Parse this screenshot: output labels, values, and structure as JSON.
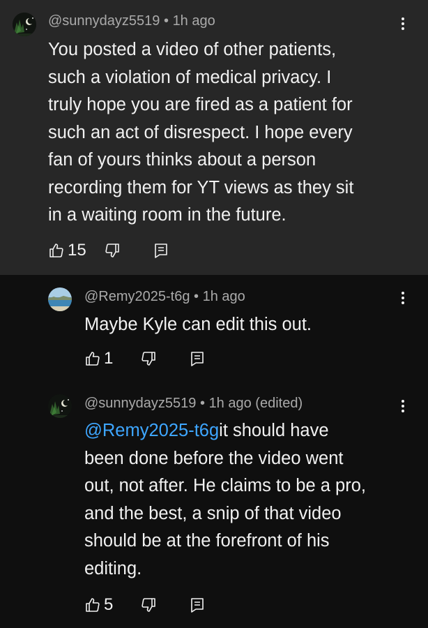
{
  "comments": [
    {
      "author": "@sunnydayz5519",
      "time": "1h ago",
      "text": "You posted a video of other patients, such a violation of medical privacy. I truly hope you are fired as a patient for such an act of disrespect. I hope every fan of yours thinks about a person recording them for YT views as they sit in a waiting room in the future.",
      "lines": [
        "You posted a video of other patients,",
        "such a violation of medical privacy. I",
        "truly hope you are fired as a patient for",
        "such an act of disrespect. I hope every",
        "fan of yours thinks about a person",
        "recording them for YT views as they sit",
        "in a waiting room in the future."
      ],
      "likes": "15",
      "avatar_icon": "night-landscape-avatar"
    },
    {
      "author": "@Remy2025-t6g",
      "time": "1h ago",
      "text": "Maybe Kyle can edit this out.",
      "likes": "1",
      "avatar_icon": "beach-avatar"
    },
    {
      "author": "@sunnydayz5519",
      "time": "1h ago (edited)",
      "mention": "@Remy2025-t6g",
      "text": "it should have been done before the video went out, not after. He claims to be a pro, and the best, a snip of that video should be at the forefront of his editing.",
      "lines": [
        "it should have",
        "been done before the video went",
        "out, not after. He claims to be a pro,",
        "and the best, a snip of that video",
        "should be at the forefront of his",
        "editing."
      ],
      "likes": "5",
      "avatar_icon": "night-landscape-avatar"
    }
  ],
  "separator": "•",
  "colors": {
    "background": "#0f0f0f",
    "highlighted_comment_bg": "#272727",
    "meta_text": "#aaaaaa",
    "mention_link": "#3ea6ff"
  }
}
